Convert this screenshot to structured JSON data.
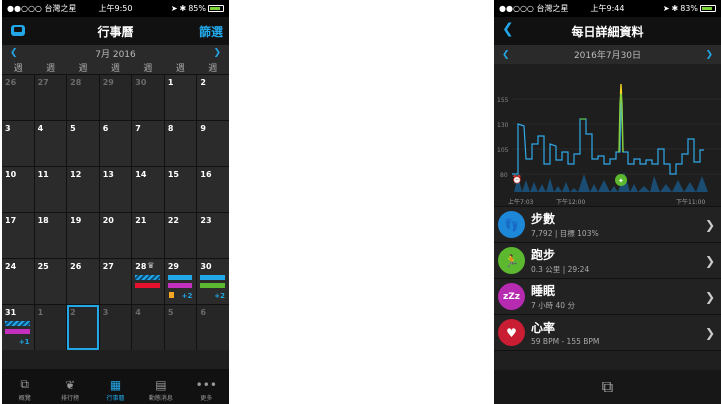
{
  "left": {
    "status": {
      "carrier": "●●○○○ 台灣之星",
      "time": "上午9:50",
      "battery": "85%",
      "battery_level": 0.85
    },
    "title": "行事曆",
    "filter": "篩選",
    "month": "7月 2016",
    "weekdays": [
      "週",
      "週",
      "週",
      "週",
      "週",
      "週",
      "週"
    ],
    "rows": [
      [
        "26",
        "27",
        "28",
        "29",
        "30",
        "1",
        "2"
      ],
      [
        "3",
        "4",
        "5",
        "6",
        "7",
        "8",
        "9"
      ],
      [
        "10",
        "11",
        "12",
        "13",
        "14",
        "15",
        "16"
      ],
      [
        "17",
        "18",
        "19",
        "20",
        "21",
        "22",
        "23"
      ],
      [
        "24",
        "25",
        "26",
        "27",
        "28",
        "29",
        "30"
      ],
      [
        "31",
        "1",
        "2",
        "3",
        "4",
        "5",
        "6"
      ]
    ],
    "plus_29": "+2",
    "plus_30": "+2",
    "plus_31": "+1",
    "tabs": [
      {
        "label": "概覽",
        "icon": "overview-icon"
      },
      {
        "label": "排行榜",
        "icon": "leaderboard-icon"
      },
      {
        "label": "行事曆",
        "icon": "calendar-icon"
      },
      {
        "label": "動態消息",
        "icon": "news-icon"
      },
      {
        "label": "更多",
        "icon": "more-icon"
      }
    ],
    "colors": {
      "accent": "#22a7e8",
      "red": "#e8112d",
      "magenta": "#c42fc0",
      "green": "#5cb82e",
      "orange": "#f5a623"
    }
  },
  "right": {
    "status": {
      "carrier": "●●○○○ 台灣之星",
      "time": "上午9:44",
      "battery": "83%",
      "battery_level": 0.83
    },
    "title": "每日詳細資料",
    "date": "2016年7月30日",
    "chart": {
      "y_ticks": [
        "155",
        "130",
        "105",
        "80"
      ],
      "x_ticks": [
        "上午7:03",
        "下午12:00",
        "下午11:00"
      ]
    },
    "items": [
      {
        "title": "步數",
        "sub": "7,792  |  目標 103%",
        "color": "#1e88d8",
        "icon": "footsteps-icon"
      },
      {
        "title": "跑步",
        "sub": "0.3 公里  |  29:24",
        "color": "#5cb82e",
        "icon": "runner-icon"
      },
      {
        "title": "睡眠",
        "sub": "7 小時 40 分",
        "color": "#b62bb0",
        "icon": "sleep-icon"
      },
      {
        "title": "心率",
        "sub": "59 BPM - 155 BPM",
        "color": "#c81d33",
        "icon": "heart-icon"
      }
    ]
  }
}
